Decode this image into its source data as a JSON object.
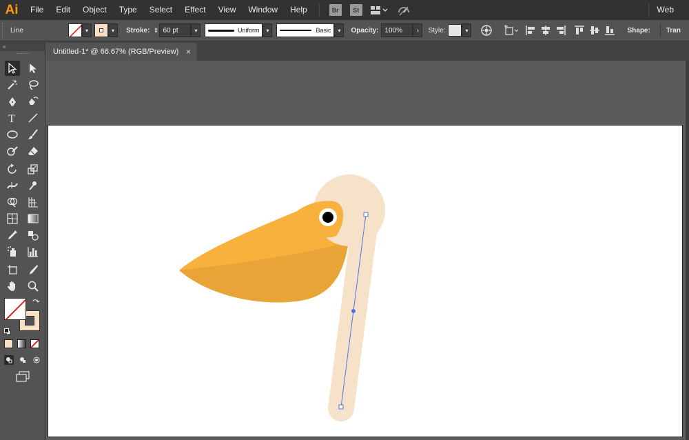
{
  "app": {
    "logo": "Ai",
    "menu": [
      "File",
      "Edit",
      "Object",
      "Type",
      "Select",
      "Effect",
      "View",
      "Window",
      "Help"
    ],
    "bridge_label": "Br",
    "stock_label": "St",
    "workspace": "Web"
  },
  "control_bar": {
    "selection_type": "Line",
    "stroke_label": "Stroke:",
    "stroke_weight": "60 pt",
    "variable_width": "Uniform",
    "brush": "Basic",
    "opacity_label": "Opacity:",
    "opacity": "100%",
    "style_label": "Style:",
    "shape_label": "Shape:",
    "transform_label": "Tran"
  },
  "document": {
    "tab_title": "Untitled-1* @ 66.67% (RGB/Preview)",
    "close_glyph": "×"
  },
  "colors": {
    "beak_light": "#F9B13E",
    "beak_dark": "#E9A437",
    "head": "#F6E2C8",
    "eye_ring": "#FFFFFF",
    "eye": "#000000",
    "selection": "#4A74E8",
    "stroke_swatch": "#F8E0C4",
    "app_accent": "#FF9A00"
  },
  "icons": [
    "selection-tool-icon",
    "direct-selection-icon",
    "magic-wand-icon",
    "lasso-icon",
    "pen-icon",
    "curvature-icon",
    "type-icon",
    "line-segment-icon",
    "ellipse-icon",
    "paintbrush-icon",
    "shaper-icon",
    "eraser-icon",
    "rotate-icon",
    "scale-icon",
    "width-icon",
    "puppet-warp-icon",
    "shape-builder-icon",
    "perspective-grid-icon",
    "mesh-icon",
    "gradient-icon",
    "eyedropper-icon",
    "blend-icon",
    "symbol-sprayer-icon",
    "column-graph-icon",
    "artboard-icon",
    "slice-icon",
    "hand-icon",
    "zoom-icon"
  ]
}
